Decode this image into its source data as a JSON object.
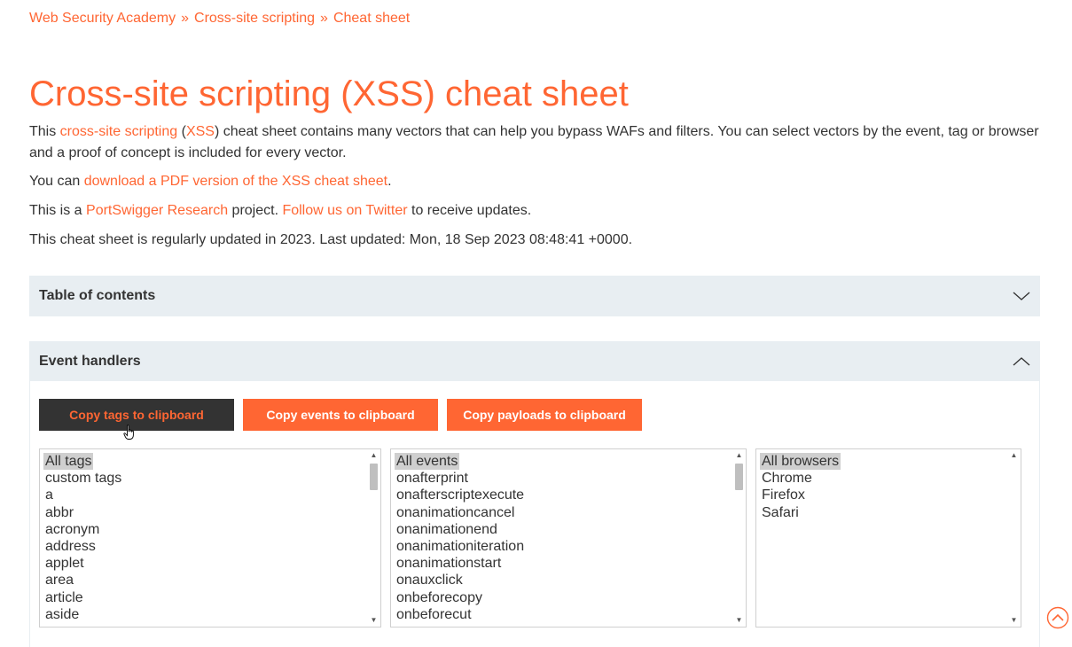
{
  "breadcrumb": {
    "items": [
      "Web Security Academy",
      "Cross-site scripting",
      "Cheat sheet"
    ],
    "separator": "»"
  },
  "page_title": "Cross-site scripting (XSS) cheat sheet",
  "intro": {
    "p1_pre": "This ",
    "p1_link1": "cross-site scripting",
    "p1_mid1": " (",
    "p1_link2": "XSS",
    "p1_post": ") cheat sheet contains many vectors that can help you bypass WAFs and filters. You can select vectors by the event, tag or browser and a proof of concept is included for every vector.",
    "p2_pre": "You can ",
    "p2_link": "download a PDF version of the XSS cheat sheet",
    "p2_post": ".",
    "p3_pre": "This is a ",
    "p3_link1": "PortSwigger Research",
    "p3_mid": " project. ",
    "p3_link2": "Follow us on Twitter",
    "p3_post": " to receive updates.",
    "p4": "This cheat sheet is regularly updated in 2023. Last updated: Mon, 18 Sep 2023 08:48:41 +0000."
  },
  "toc": {
    "label": "Table of contents"
  },
  "event_handlers": {
    "label": "Event handlers",
    "buttons": {
      "copy_tags": "Copy tags to clipboard",
      "copy_events": "Copy events to clipboard",
      "copy_payloads": "Copy payloads to clipboard"
    },
    "tags": [
      "All tags",
      "custom tags",
      "a",
      "abbr",
      "acronym",
      "address",
      "applet",
      "area",
      "article",
      "aside"
    ],
    "events": [
      "All events",
      "onafterprint",
      "onafterscriptexecute",
      "onanimationcancel",
      "onanimationend",
      "onanimationiteration",
      "onanimationstart",
      "onauxclick",
      "onbeforecopy",
      "onbeforecut"
    ],
    "browsers": [
      "All browsers",
      "Chrome",
      "Firefox",
      "Safari"
    ]
  },
  "colors": {
    "accent": "#ff6633",
    "panel_bg": "#e8eef2",
    "dark_button": "#333333"
  }
}
